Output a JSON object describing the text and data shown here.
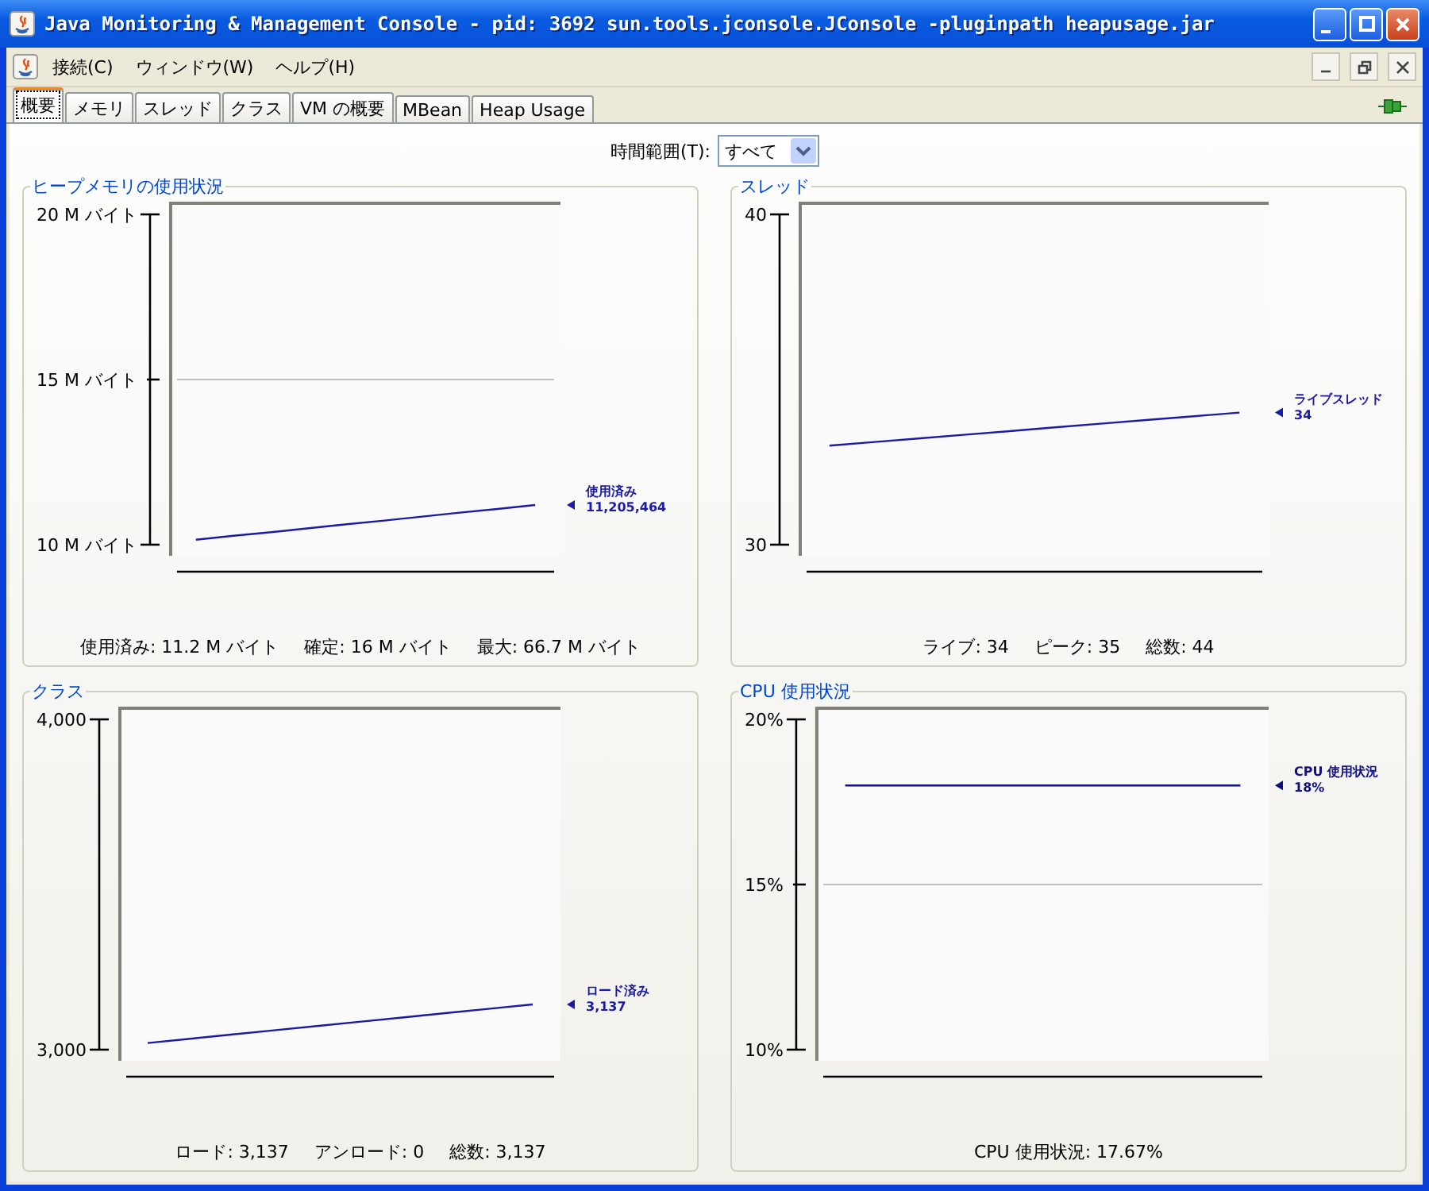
{
  "window": {
    "title": "Java Monitoring & Management Console - pid: 3692 sun.tools.jconsole.JConsole -pluginpath heapusage.jar"
  },
  "menu": [
    "接続(C)",
    "ウィンドウ(W)",
    "ヘルプ(H)"
  ],
  "tabs": [
    {
      "label": "概要",
      "selected": true
    },
    {
      "label": "メモリ",
      "selected": false
    },
    {
      "label": "スレッド",
      "selected": false
    },
    {
      "label": "クラス",
      "selected": false
    },
    {
      "label": "VM の概要",
      "selected": false
    },
    {
      "label": "MBean",
      "selected": false
    },
    {
      "label": "Heap Usage",
      "selected": false
    }
  ],
  "time_range": {
    "label": "時間範囲(T):",
    "value": "すべて"
  },
  "panels": [
    {
      "title": "ヒープメモリの使用状況",
      "legend_value": "11,205,464",
      "summary": [
        "使用済み: 11.2 M バイト",
        "確定: 16 M バイト",
        "最大: 66.7 M バイト"
      ],
      "chart_data": {
        "type": "line",
        "categories": [
          null,
          null,
          null,
          null,
          null,
          null,
          null,
          null,
          null,
          null
        ],
        "ylim": [
          10000000,
          20000000
        ],
        "yticks": [
          {
            "value": 10000000,
            "label": "10 M バイト"
          },
          {
            "value": 15000000,
            "label": "15 M バイト"
          },
          {
            "value": 20000000,
            "label": "20 M バイト"
          }
        ],
        "series": [
          {
            "name": "使用済み",
            "color": "#1a1aa6",
            "values": [
              10150000,
              10270000,
              10380000,
              10500000,
              10620000,
              10730000,
              10850000,
              10970000,
              11080000,
              11200000
            ]
          }
        ]
      }
    },
    {
      "title": "スレッド",
      "legend_value": "34",
      "summary": [
        "ライブ: 34",
        "ピーク: 35",
        "総数: 44"
      ],
      "chart_data": {
        "type": "line",
        "categories": [
          null,
          null,
          null,
          null,
          null,
          null,
          null,
          null,
          null,
          null
        ],
        "ylim": [
          30,
          40
        ],
        "yticks": [
          {
            "value": 30,
            "label": "30"
          },
          {
            "value": 40,
            "label": "40"
          }
        ],
        "series": [
          {
            "name": "ライブスレッド",
            "color": "#1a1aa6",
            "values": [
              33,
              33.11,
              33.22,
              33.33,
              33.44,
              33.56,
              33.67,
              33.78,
              33.89,
              34
            ]
          }
        ]
      }
    },
    {
      "title": "クラス",
      "legend_value": "3,137",
      "summary": [
        "ロード: 3,137",
        "アンロード: 0",
        "総数: 3,137"
      ],
      "chart_data": {
        "type": "line",
        "categories": [
          null,
          null,
          null,
          null,
          null,
          null,
          null,
          null,
          null,
          null
        ],
        "ylim": [
          3000,
          4000
        ],
        "yticks": [
          {
            "value": 3000,
            "label": "3,000"
          },
          {
            "value": 4000,
            "label": "4,000"
          }
        ],
        "series": [
          {
            "name": "ロード済み",
            "color": "#1a1aa6",
            "values": [
              3020,
              3033,
              3046,
              3059,
              3072,
              3085,
              3098,
              3111,
              3124,
              3137
            ]
          }
        ]
      }
    },
    {
      "title": "CPU 使用状況",
      "legend_value": "18%",
      "summary": [
        "CPU 使用状況: 17.67%"
      ],
      "chart_data": {
        "type": "line",
        "categories": [
          null,
          null,
          null,
          null,
          null,
          null,
          null,
          null,
          null,
          null
        ],
        "ylim": [
          10,
          20
        ],
        "yticks": [
          {
            "value": 10,
            "label": "10%"
          },
          {
            "value": 15,
            "label": "15%"
          },
          {
            "value": 20,
            "label": "20%"
          }
        ],
        "series": [
          {
            "name": "CPU 使用状況",
            "color": "#101080",
            "values": [
              18,
              18,
              18,
              18,
              18,
              18,
              18,
              18,
              18,
              18
            ]
          }
        ]
      }
    }
  ]
}
